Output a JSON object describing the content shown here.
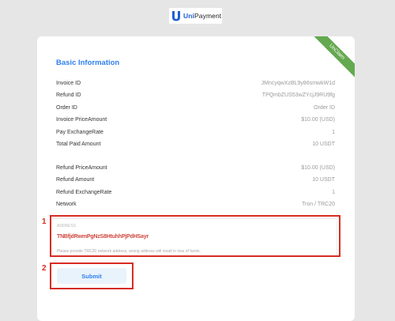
{
  "brand": {
    "name_part1": "Uni",
    "name_part2": "Payment"
  },
  "card": {
    "ribbon": "UnClaim",
    "section_title": "Basic Information",
    "rows_top": [
      {
        "label": "Invoice ID",
        "value": "JMncyqwXzBL9y86smwkW1d"
      },
      {
        "label": "Refund ID",
        "value": "TPQmbZUS53wZYcjJ9RU9fg"
      },
      {
        "label": "Order ID",
        "value": "Order ID"
      },
      {
        "label": "Invoice PriceAmount",
        "value": "$10.00 (USD)"
      },
      {
        "label": "Pay ExchangeRate",
        "value": "1"
      },
      {
        "label": "Total Paid Amount",
        "value": "10 USDT"
      }
    ],
    "rows_bottom": [
      {
        "label": "Refund PriceAmount",
        "value": "$10.00 (USD)"
      },
      {
        "label": "Refund Amount",
        "value": "10 USDT"
      },
      {
        "label": "Refund ExchangeRate",
        "value": "1"
      },
      {
        "label": "Network",
        "value": "Tron / TRC20"
      }
    ],
    "address": {
      "caption": "ADDRESS",
      "value": "TNBfjdRwmPgNzS8HtuhhPjPdHSayr",
      "hint": "Please provide TRC20 network address, wrong address will result in loss of funds."
    },
    "submit_label": "Submit"
  },
  "annotations": {
    "marker_1": "1",
    "marker_2": "2",
    "color": "#d72c22"
  },
  "colors": {
    "accent": "#2f80ed",
    "ribbon": "#64a94f",
    "background": "#e6e6e6"
  }
}
